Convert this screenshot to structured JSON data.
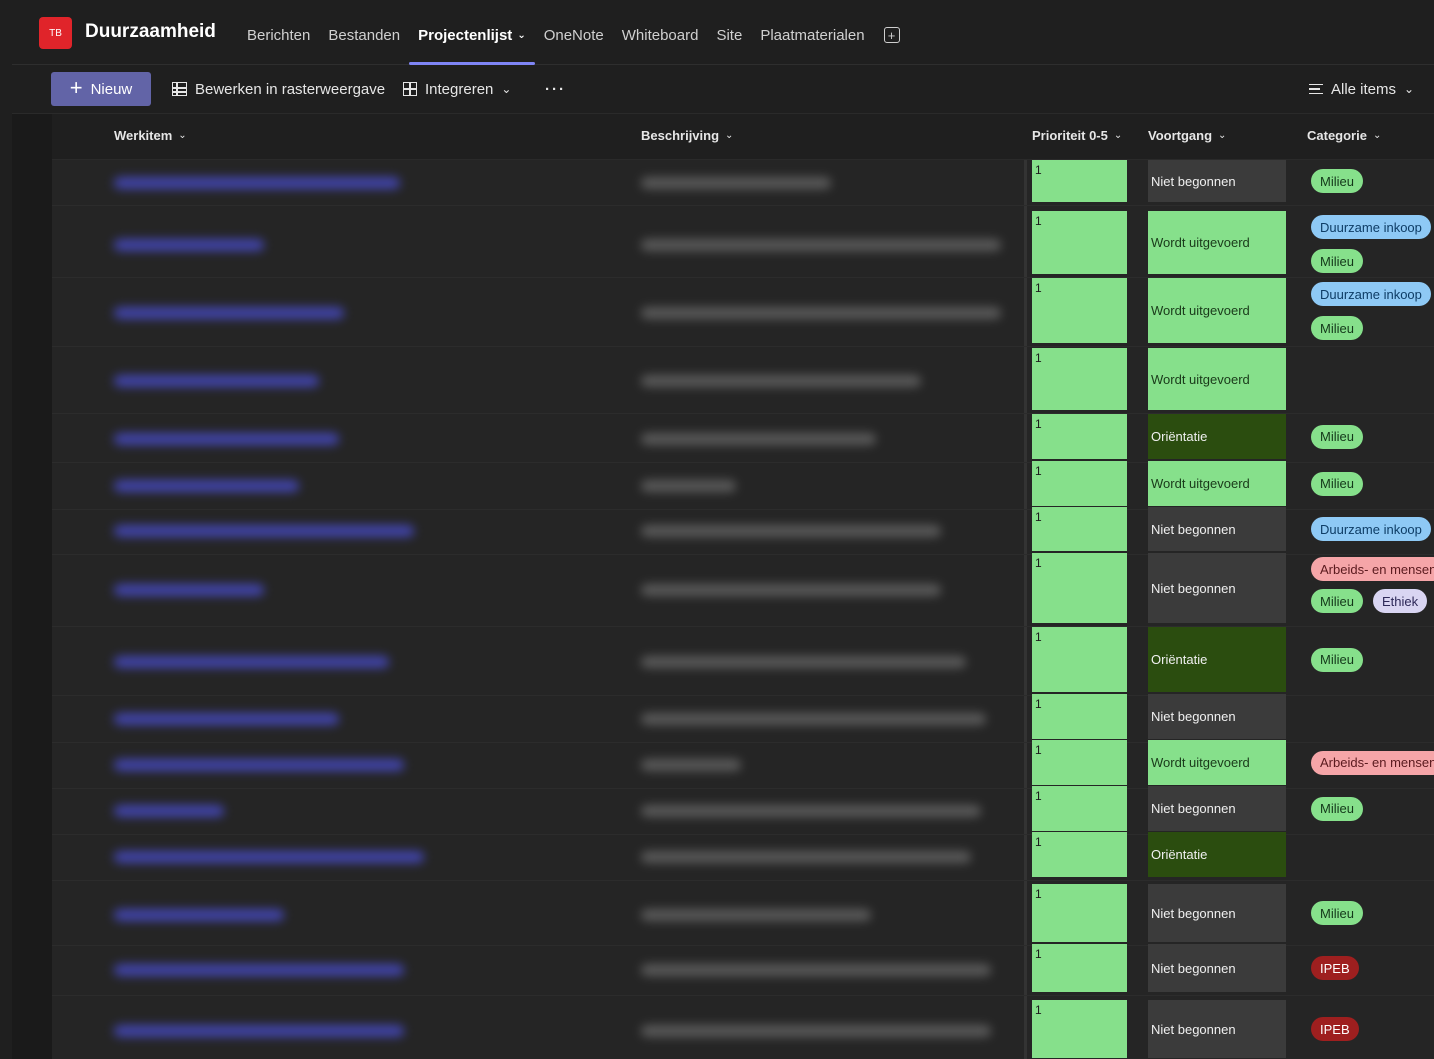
{
  "team": {
    "avatar_text": "TB",
    "name": "Duurzaamheid"
  },
  "tabs": [
    {
      "label": "Berichten",
      "active": false
    },
    {
      "label": "Bestanden",
      "active": false
    },
    {
      "label": "Projectenlijst",
      "active": true,
      "dropdown": true
    },
    {
      "label": "OneNote",
      "active": false
    },
    {
      "label": "Whiteboard",
      "active": false
    },
    {
      "label": "Site",
      "active": false
    },
    {
      "label": "Plaatmaterialen",
      "active": false
    }
  ],
  "commands": {
    "new_label": "Nieuw",
    "grid_edit_label": "Bewerken in rasterweergave",
    "integrate_label": "Integreren",
    "more_label": "···",
    "view_label": "Alle items"
  },
  "columns": {
    "werkitem": "Werkitem",
    "beschrijving": "Beschrijving",
    "prioriteit": "Prioriteit 0-5",
    "voortgang": "Voortgang",
    "categorie": "Categorie"
  },
  "colors": {
    "accent": "#6264a7",
    "priority_green": "#86e08b",
    "status_niet": "#3b3b3b",
    "status_wordt": "#86e08b",
    "status_orient": "#2b4d0f"
  },
  "rows": [
    {
      "prioriteit": "1",
      "voortgang": "Niet begonnen",
      "categorie": [
        "Milieu"
      ]
    },
    {
      "prioriteit": "1",
      "voortgang": "Wordt uitgevoerd",
      "categorie": [
        "Duurzame inkoop",
        "Milieu"
      ]
    },
    {
      "prioriteit": "1",
      "voortgang": "Wordt uitgevoerd",
      "categorie": [
        "Duurzame inkoop",
        "Milieu"
      ]
    },
    {
      "prioriteit": "1",
      "voortgang": "Wordt uitgevoerd",
      "categorie": []
    },
    {
      "prioriteit": "1",
      "voortgang": "Oriëntatie",
      "categorie": [
        "Milieu"
      ]
    },
    {
      "prioriteit": "1",
      "voortgang": "Wordt uitgevoerd",
      "categorie": [
        "Milieu"
      ]
    },
    {
      "prioriteit": "1",
      "voortgang": "Niet begonnen",
      "categorie": [
        "Duurzame inkoop"
      ]
    },
    {
      "prioriteit": "1",
      "voortgang": "Niet begonnen",
      "categorie": [
        "Arbeids- en mensen",
        "Milieu",
        "Ethiek"
      ]
    },
    {
      "prioriteit": "1",
      "voortgang": "Oriëntatie",
      "categorie": [
        "Milieu"
      ]
    },
    {
      "prioriteit": "1",
      "voortgang": "Niet begonnen",
      "categorie": []
    },
    {
      "prioriteit": "1",
      "voortgang": "Wordt uitgevoerd",
      "categorie": [
        "Arbeids- en mensen"
      ]
    },
    {
      "prioriteit": "1",
      "voortgang": "Niet begonnen",
      "categorie": [
        "Milieu"
      ]
    },
    {
      "prioriteit": "1",
      "voortgang": "Oriëntatie",
      "categorie": []
    },
    {
      "prioriteit": "1",
      "voortgang": "Niet begonnen",
      "categorie": [
        "Milieu"
      ]
    },
    {
      "prioriteit": "1",
      "voortgang": "Niet begonnen",
      "categorie": [
        "IPEB"
      ]
    },
    {
      "prioriteit": "1",
      "voortgang": "Niet begonnen",
      "categorie": [
        "IPEB"
      ]
    }
  ]
}
